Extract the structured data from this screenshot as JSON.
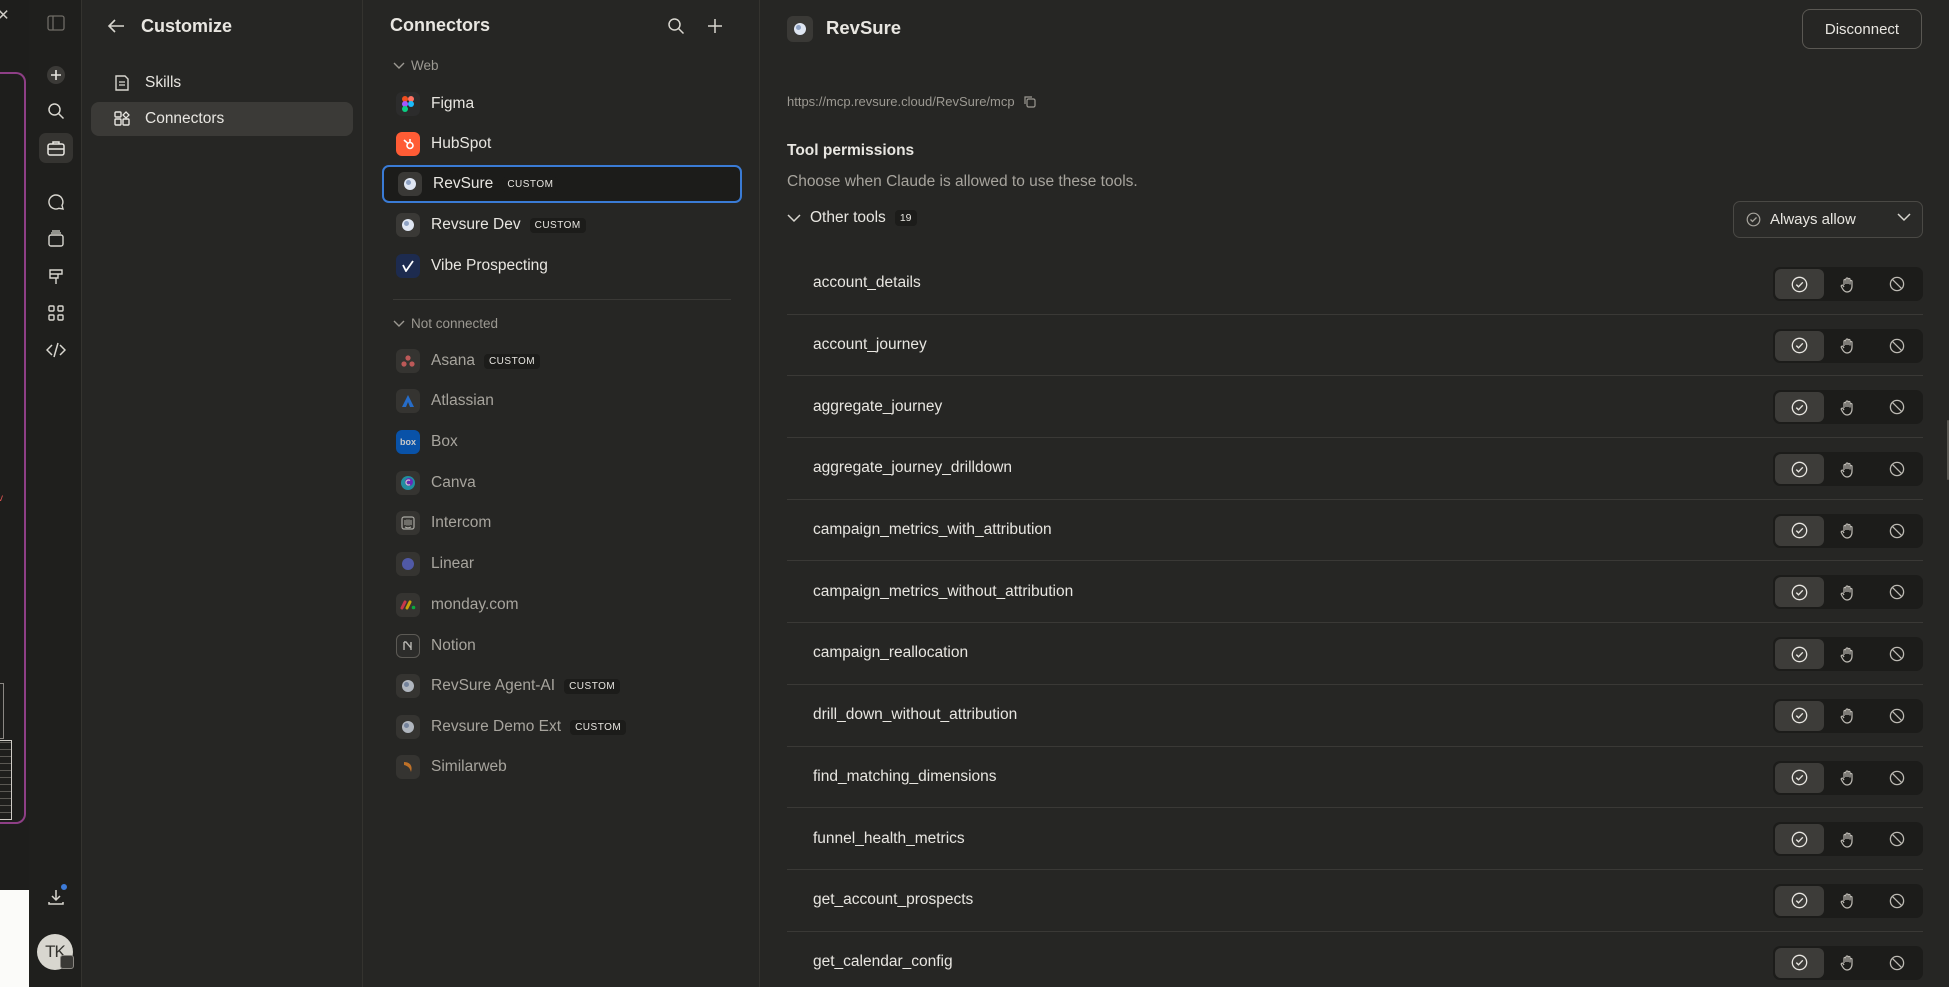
{
  "customize": {
    "title": "Customize",
    "nav": [
      {
        "label": "Skills",
        "icon": "skills-icon"
      },
      {
        "label": "Connectors",
        "icon": "connectors-icon",
        "active": true
      }
    ]
  },
  "connectors": {
    "title": "Connectors",
    "groups": [
      {
        "label": "Web",
        "items": [
          {
            "name": "Figma",
            "logo": "figma-logo"
          },
          {
            "name": "HubSpot",
            "logo": "hubspot-logo"
          },
          {
            "name": "RevSure",
            "badge": "CUSTOM",
            "logo": "globe-logo",
            "selected": true
          },
          {
            "name": "Revsure Dev",
            "badge": "CUSTOM",
            "logo": "globe-logo"
          },
          {
            "name": "Vibe Prospecting",
            "logo": "vibe-logo"
          }
        ]
      },
      {
        "label": "Not connected",
        "items": [
          {
            "name": "Asana",
            "badge": "CUSTOM",
            "logo": "asana-logo"
          },
          {
            "name": "Atlassian",
            "logo": "atlassian-logo"
          },
          {
            "name": "Box",
            "logo": "box-logo",
            "logo_text": "box"
          },
          {
            "name": "Canva",
            "logo": "canva-logo"
          },
          {
            "name": "Intercom",
            "logo": "intercom-logo"
          },
          {
            "name": "Linear",
            "logo": "linear-logo"
          },
          {
            "name": "monday.com",
            "logo": "monday-logo"
          },
          {
            "name": "Notion",
            "logo": "notion-logo"
          },
          {
            "name": "RevSure Agent-AI",
            "badge": "CUSTOM",
            "logo": "globe-logo"
          },
          {
            "name": "Revsure Demo Ext",
            "badge": "CUSTOM",
            "logo": "globe-logo"
          },
          {
            "name": "Similarweb",
            "logo": "similarweb-logo"
          }
        ]
      }
    ]
  },
  "detail": {
    "title": "RevSure",
    "disconnect_label": "Disconnect",
    "url": "https://mcp.revsure.cloud/RevSure/mcp",
    "permissions_title": "Tool permissions",
    "permissions_desc": "Choose when Claude is allowed to use these tools.",
    "group_name": "Other tools",
    "group_count": "19",
    "group_policy": "Always allow",
    "tools": [
      "account_details",
      "account_journey",
      "aggregate_journey",
      "aggregate_journey_drilldown",
      "campaign_metrics_with_attribution",
      "campaign_metrics_without_attribution",
      "campaign_reallocation",
      "drill_down_without_attribution",
      "find_matching_dimensions",
      "funnel_health_metrics",
      "get_account_prospects",
      "get_calendar_config"
    ],
    "tool_selected_option": "always-allow"
  },
  "rail": {
    "avatar_initials": "TK"
  },
  "colors": {
    "background": "#262624",
    "accent_selected_border": "#3a7bd5",
    "badge_bg": "#1c1c1a"
  }
}
